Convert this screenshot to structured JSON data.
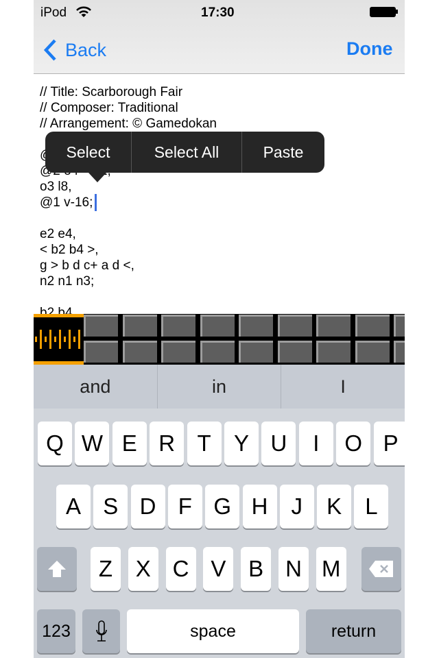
{
  "status_bar": {
    "carrier": "iPod",
    "time": "17:30",
    "wifi_icon": "wifi-icon",
    "battery_icon": "battery-icon"
  },
  "nav": {
    "back_label": "Back",
    "done_label": "Done",
    "accent": "#1b7cf2"
  },
  "editor": {
    "lines": [
      "// Title: Scarborough Fair",
      "// Composer: Traditional",
      "// Arrangement: © Gamedokan",
      "@",
      "@2 o4      2,",
      "o3 l8,",
      "@1 v-16;",
      "",
      "e2 e4,",
      "< b2 b4 >,",
      "g > b d c+ a d <,",
      "n2 n1 n3;",
      "",
      "b2 b4"
    ]
  },
  "context_menu": {
    "items": [
      "Select",
      "Select All",
      "Paste"
    ]
  },
  "sequencer_strip": {
    "icon": "waveform-icon",
    "accent": "#f5a000"
  },
  "suggestions": [
    "and",
    "in",
    "I"
  ],
  "keyboard": {
    "row1": [
      "Q",
      "W",
      "E",
      "R",
      "T",
      "Y",
      "U",
      "I",
      "O",
      "P"
    ],
    "row2": [
      "A",
      "S",
      "D",
      "F",
      "G",
      "H",
      "J",
      "K",
      "L"
    ],
    "row3": [
      "Z",
      "X",
      "C",
      "V",
      "B",
      "N",
      "M"
    ],
    "numbers_label": "123",
    "space_label": "space",
    "return_label": "return"
  }
}
